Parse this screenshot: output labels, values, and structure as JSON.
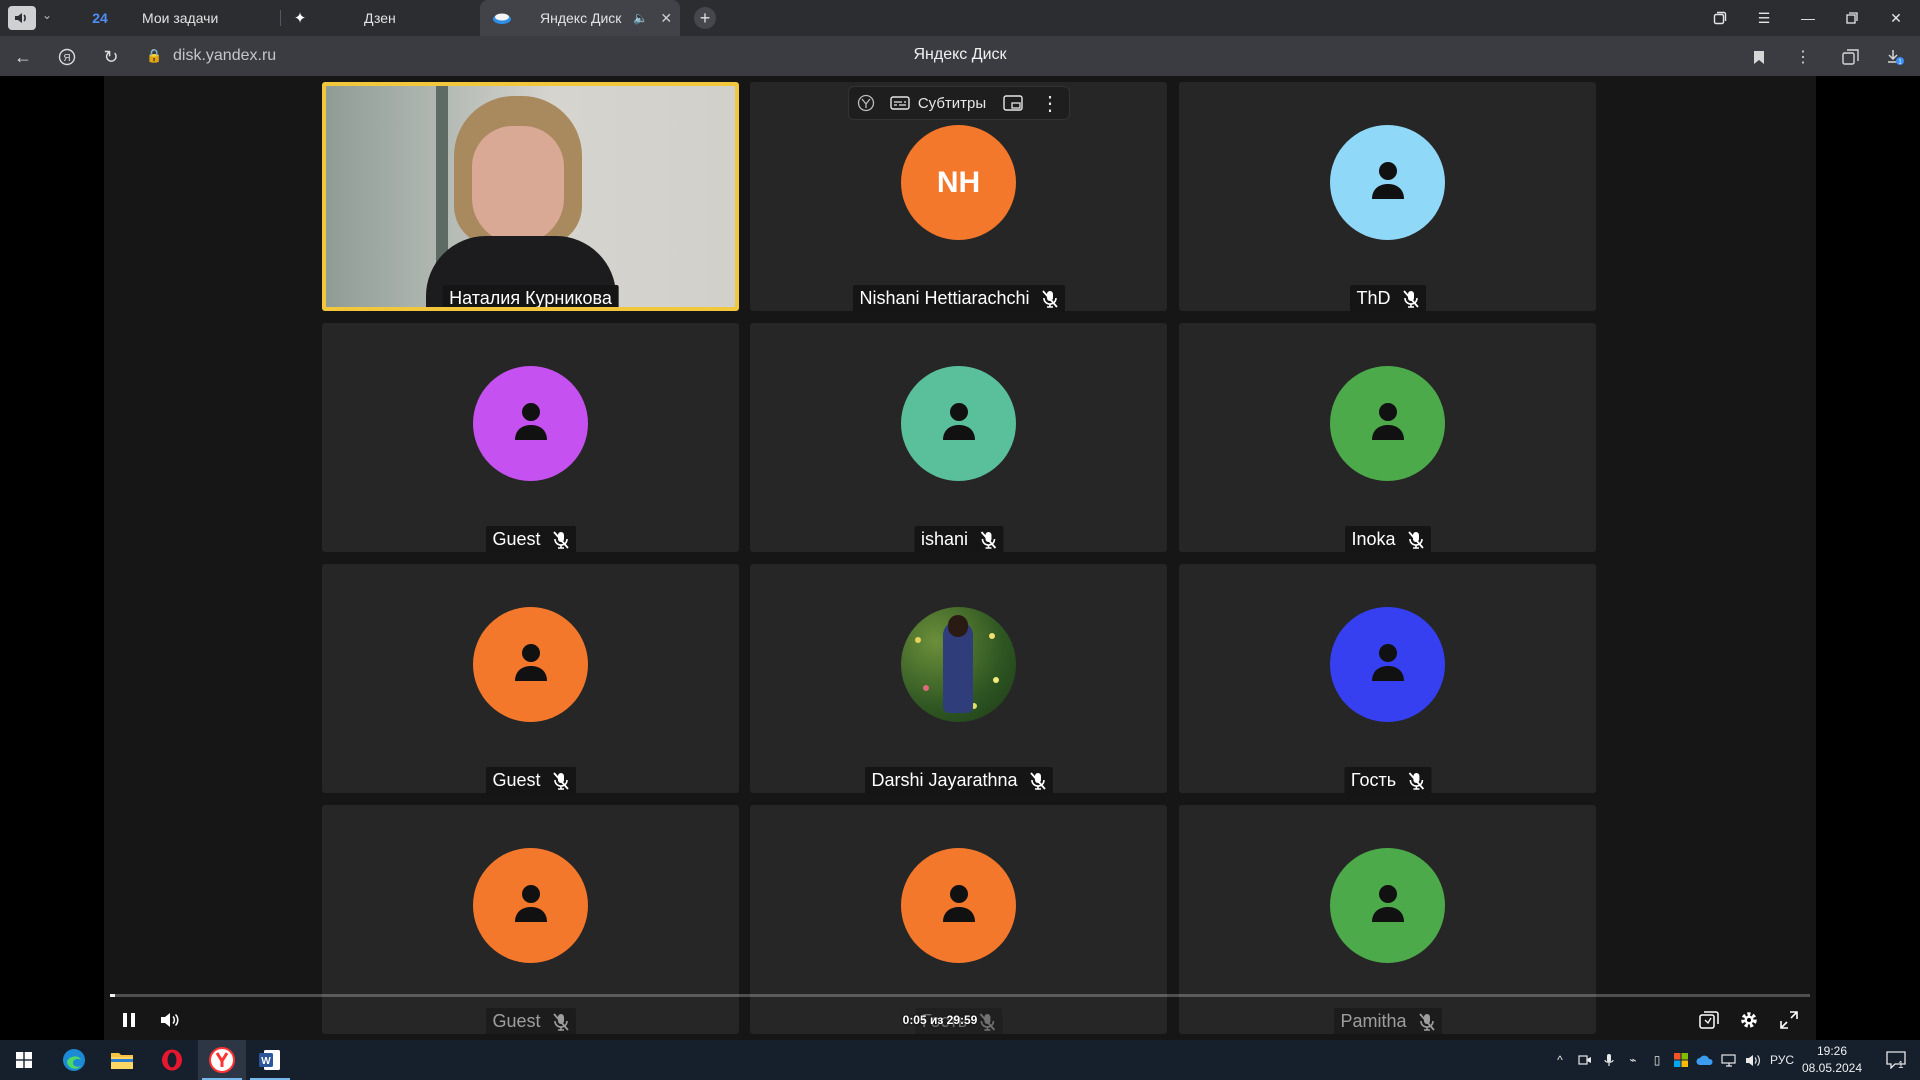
{
  "browser": {
    "tabs": [
      {
        "label": "Мои задачи",
        "icon": "tasks-24-icon",
        "icon_text": "24"
      },
      {
        "label": "Дзен",
        "icon": "dzen-star-icon"
      },
      {
        "label": "Яндекс Диск",
        "icon": "yandex-disk-icon",
        "active": true
      }
    ],
    "url": "disk.yandex.ru",
    "page_title": "Яндекс Диск"
  },
  "meeting": {
    "toolbar": {
      "subtitles_label": "Субтитры"
    },
    "participants": [
      {
        "name": "Наталия Курникова",
        "type": "video",
        "speaking": true
      },
      {
        "name": "Nishani Hettiarachchi",
        "initials": "NH",
        "color": "#f4782b",
        "muted": true
      },
      {
        "name": "ThD",
        "color": "#8fd8f7",
        "muted": true
      },
      {
        "name": "Guest",
        "color": "#c552f0",
        "muted": true
      },
      {
        "name": "ishani",
        "color": "#5ac09c",
        "muted": true
      },
      {
        "name": "Inoka",
        "color": "#4caa4a",
        "muted": true
      },
      {
        "name": "Guest",
        "color": "#f4782b",
        "muted": true
      },
      {
        "name": "Darshi Jayarathna",
        "type": "photo",
        "muted": true
      },
      {
        "name": "Гость",
        "color": "#3640f0",
        "muted": true
      },
      {
        "name": "Guest",
        "color": "#f4782b",
        "muted": true
      },
      {
        "name": "Гость",
        "color": "#f4782b",
        "muted": true
      },
      {
        "name": "Pamitha",
        "color": "#4caa4a",
        "muted": true
      }
    ]
  },
  "player": {
    "timecode": "0:05 из 29:59",
    "progress_fraction": 0.0028,
    "state": "playing"
  },
  "taskbar": {
    "apps": [
      "windows-start-icon",
      "edge-icon",
      "file-explorer-icon",
      "opera-icon",
      "yandex-browser-icon",
      "word-icon"
    ],
    "language": "РУС",
    "time": "19:26",
    "date": "08.05.2024",
    "notifications": "1"
  },
  "colors": {
    "accent_speaking": "#f3c73b",
    "tile_bg": "#262626",
    "taskbar_bg": "#16202c"
  }
}
